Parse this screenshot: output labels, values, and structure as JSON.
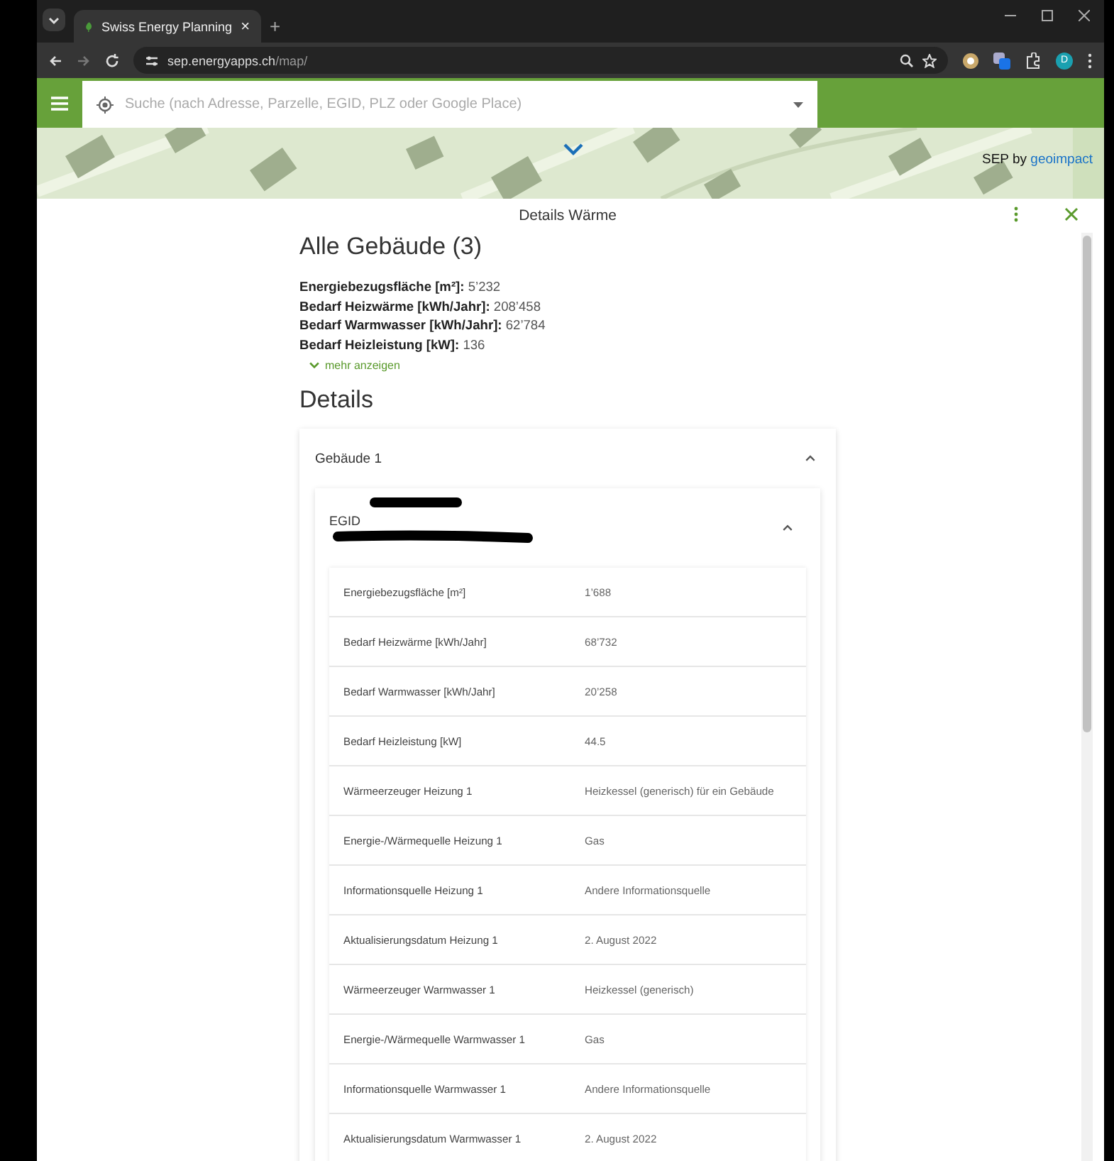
{
  "browser": {
    "tab_title": "Swiss Energy Planning",
    "tab_close": "×",
    "new_tab": "+",
    "url_host": "sep.energyapps.ch",
    "url_path": "/map/",
    "profile_initial": "D"
  },
  "app_bar": {
    "search": {
      "placeholder": "Suche (nach Adresse, Parzelle, EGID, PLZ oder Google Place)"
    }
  },
  "map": {
    "attribution_prefix": "SEP by",
    "attribution_link": "geoimpact"
  },
  "panel": {
    "title": "Details Wärme",
    "heading": "Alle Gebäude (3)",
    "summary": [
      {
        "label": "Energiebezugsfläche [m²]:",
        "value": "5’232"
      },
      {
        "label": "Bedarf Heizwärme [kWh/Jahr]:",
        "value": "208’458"
      },
      {
        "label": "Bedarf Warmwasser [kWh/Jahr]:",
        "value": "62’784"
      },
      {
        "label": "Bedarf Heizleistung [kW]:",
        "value": "136"
      }
    ],
    "more_link": "mehr anzeigen",
    "details_heading": "Details",
    "buildings": [
      {
        "title": "Gebäude 1",
        "expanded": true,
        "entries": [
          {
            "title": "EGID",
            "expanded": true,
            "rows": [
              {
                "label": "Energiebezugsfläche [m²]",
                "value": "1’688"
              },
              {
                "label": "Bedarf Heizwärme [kWh/Jahr]",
                "value": "68’732"
              },
              {
                "label": "Bedarf Warmwasser [kWh/Jahr]",
                "value": "20’258"
              },
              {
                "label": "Bedarf Heizleistung [kW]",
                "value": "44.5"
              },
              {
                "label": "Wärmeerzeuger Heizung 1",
                "value": "Heizkessel (generisch) für ein Gebäude"
              },
              {
                "label": "Energie-/Wärmequelle Heizung 1",
                "value": "Gas"
              },
              {
                "label": "Informationsquelle Heizung 1",
                "value": "Andere Informationsquelle"
              },
              {
                "label": "Aktualisierungsdatum Heizung 1",
                "value": "2. August 2022"
              },
              {
                "label": "Wärmeerzeuger Warmwasser 1",
                "value": "Heizkessel (generisch)"
              },
              {
                "label": "Energie-/Wärmequelle Warmwasser 1",
                "value": "Gas"
              },
              {
                "label": "Informationsquelle Warmwasser 1",
                "value": "Andere Informationsquelle"
              },
              {
                "label": "Aktualisierungsdatum Warmwasser 1",
                "value": "2. August 2022"
              }
            ]
          }
        ]
      }
    ]
  }
}
